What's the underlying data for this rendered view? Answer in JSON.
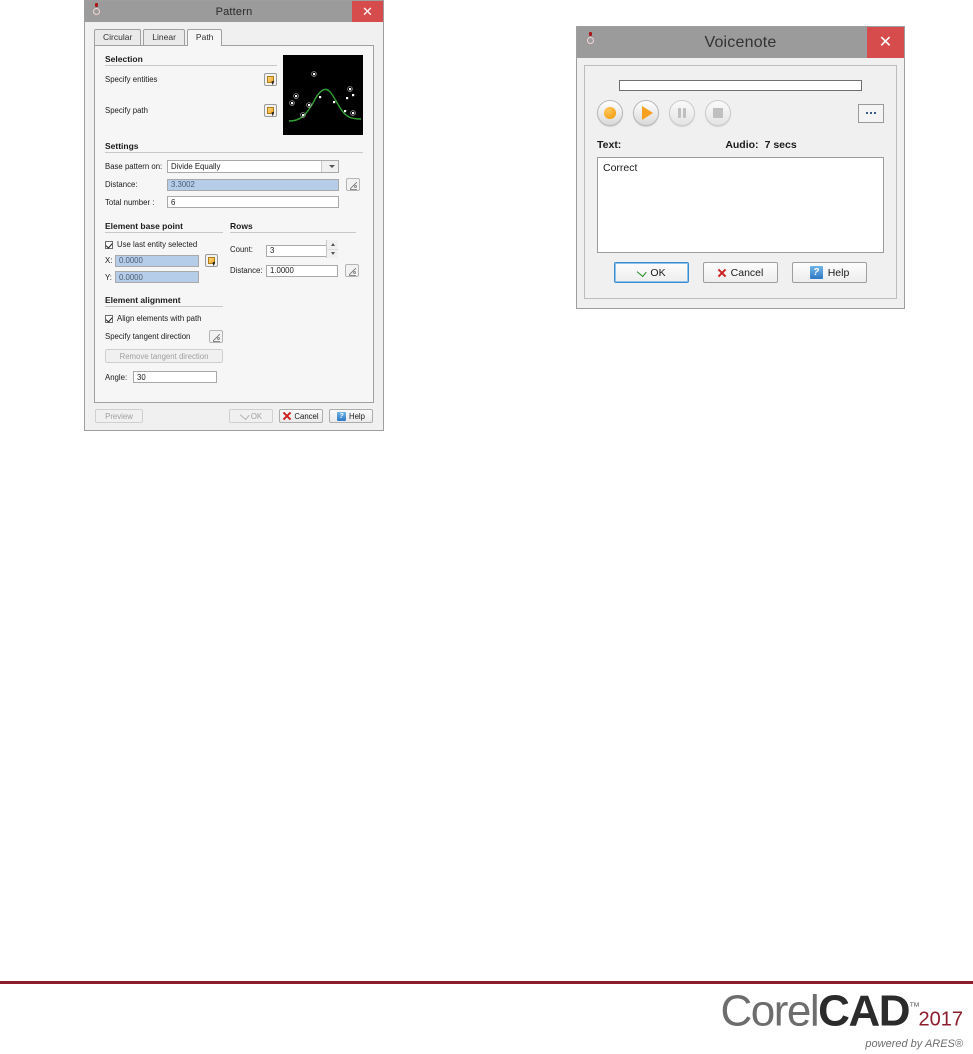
{
  "pattern_dialog": {
    "title": "Pattern",
    "app_icon": "corelcad-balloon-icon",
    "close_label": "✕",
    "tabs": [
      {
        "label": "Circular",
        "selected": false
      },
      {
        "label": "Linear",
        "selected": false
      },
      {
        "label": "Path",
        "selected": true
      }
    ],
    "selection": {
      "group_title": "Selection",
      "specify_entities_label": "Specify entities",
      "specify_path_label": "Specify path",
      "picker_icon": "select-entities-icon"
    },
    "settings": {
      "group_title": "Settings",
      "base_pattern_on_label": "Base pattern on:",
      "base_pattern_on_value": "Divide Equally",
      "distance_label": "Distance:",
      "distance_value": "3.3002",
      "distance_readonly": true,
      "total_number_label": "Total number :",
      "total_number_value": "6"
    },
    "element_base_point": {
      "group_title": "Element base point",
      "use_last_entity_label": "Use last entity selected",
      "use_last_entity_checked": true,
      "x_label": "X:",
      "x_value": "0.0000",
      "y_label": "Y:",
      "y_value": "0.0000"
    },
    "rows": {
      "group_title": "Rows",
      "count_label": "Count:",
      "count_value": "3",
      "distance_label": "Distance:",
      "distance_value": "1.0000"
    },
    "element_alignment": {
      "group_title": "Element alignment",
      "align_elements_label": "Align elements with path",
      "align_elements_checked": true,
      "specify_tangent_label": "Specify tangent direction",
      "remove_tangent_label": "Remove tangent direction",
      "remove_tangent_disabled": true,
      "angle_label": "Angle:",
      "angle_value": "30"
    },
    "footer": {
      "preview_label": "Preview",
      "preview_disabled": true,
      "ok_label": "OK",
      "ok_disabled": true,
      "cancel_label": "Cancel",
      "help_label": "Help"
    },
    "preview": {
      "name": "path-pattern-preview",
      "background": "#000000",
      "curve_color": "#35a035",
      "marker_color": "#ffffff"
    }
  },
  "voicenote_dialog": {
    "title": "Voicenote",
    "app_icon": "corelcad-balloon-icon",
    "close_label": "✕",
    "progress_value": 0,
    "controls": [
      {
        "name": "record-button",
        "icon": "record-icon",
        "disabled": false
      },
      {
        "name": "play-button",
        "icon": "play-icon",
        "disabled": false
      },
      {
        "name": "pause-button",
        "icon": "pause-icon",
        "disabled": true
      },
      {
        "name": "stop-button",
        "icon": "stop-icon",
        "disabled": true
      }
    ],
    "more_button_label": "...",
    "text_label": "Text:",
    "audio_label": "Audio:",
    "audio_duration": "7 secs",
    "note_text": "Correct",
    "footer": {
      "ok_label": "OK",
      "cancel_label": "Cancel",
      "help_label": "Help"
    }
  },
  "branding": {
    "corel": "Corel",
    "cad": "CAD",
    "tm": "™",
    "year": "2017",
    "tagline": "powered by ARES®",
    "rule_color": "#8c1d2c"
  }
}
